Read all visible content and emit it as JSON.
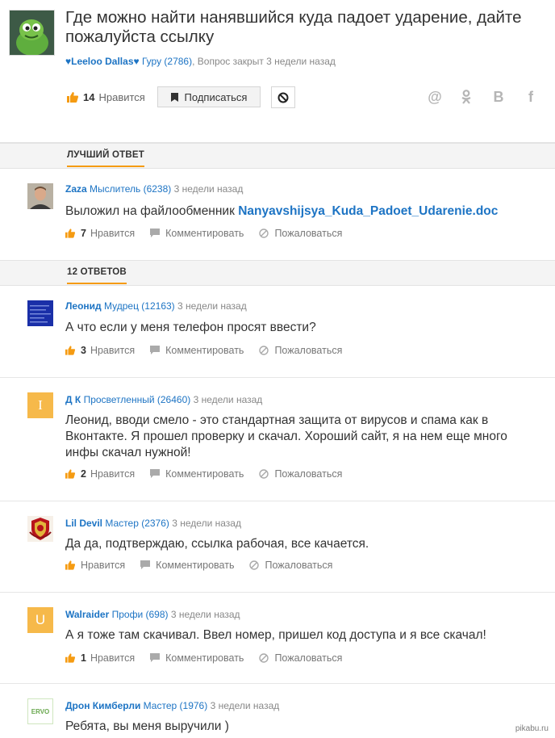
{
  "question": {
    "title": "Где можно найти нанявшийся куда падоет ударение, дайте пожалуйста ссылку",
    "author": "♥Leeloo Dallas♥",
    "author_rank": "Гуру (2786)",
    "status": ", Вопрос закрыт 3 недели назад",
    "likes_count": "14",
    "like_label": "Нравится",
    "subscribe_label": "Подписаться"
  },
  "share_icons": {
    "mail": "@",
    "ok": "ok",
    "vk": "B",
    "fb": "f"
  },
  "best_answer": {
    "section_label": "ЛУЧШИЙ ОТВЕТ",
    "author": "Zaza",
    "rank": "Мыслитель (6238)",
    "time": "3 недели назад",
    "text_prefix": "Выложил на файлообменник ",
    "link_text": "Nanyavshijsya_Kuda_Padoet_Udarenie.doc",
    "likes": "7"
  },
  "answers_section_label": "12 ОТВЕТОВ",
  "action_labels": {
    "like": "Нравится",
    "comment": "Комментировать",
    "report": "Пожаловаться"
  },
  "answers": [
    {
      "author": "Леонид",
      "rank": "Мудрец (12163)",
      "time": "3 недели назад",
      "text": "А что если у меня телефон просят ввести?",
      "likes": "3",
      "avatar_letter": ""
    },
    {
      "author": "Д К",
      "rank": "Просветленный (26460)",
      "time": "3 недели назад",
      "text": "Леонид, вводи смело - это стандартная защита от вирусов и спама как в Вконтакте. Я прошел проверку и скачал. Хороший сайт, я на нем еще много инфы скачал нужной!",
      "likes": "2",
      "avatar_letter": "I"
    },
    {
      "author": "Lil Devil",
      "rank": "Мастер (2376)",
      "time": "3 недели назад",
      "text": "Да да, подтверждаю, ссылка рабочая, все качается.",
      "likes": "",
      "avatar_letter": ""
    },
    {
      "author": "Walraider",
      "rank": "Профи (698)",
      "time": "3 недели назад",
      "text": "А я тоже там скачивал. Ввел номер, пришел код доступа и я все скачал!",
      "likes": "1",
      "avatar_letter": "U"
    },
    {
      "author": "Дрон Кимберли",
      "rank": "Мастер (1976)",
      "time": "3 недели назад",
      "text": "Ребята, вы меня выручили )",
      "likes": "",
      "avatar_letter": "ERVO"
    }
  ],
  "watermark": "pikabu.ru",
  "colors": {
    "accent": "#f59b12",
    "link": "#1d74c4",
    "avatar_yellow": "#f6b94a"
  }
}
